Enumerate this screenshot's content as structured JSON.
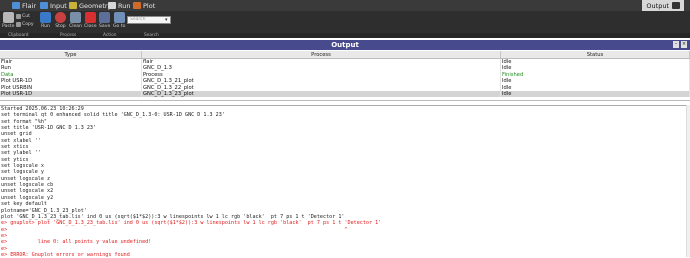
{
  "topbar": {
    "tabs": [
      {
        "label": "Flair",
        "color": "#4e8fd6"
      },
      {
        "label": "Input",
        "color": "#4e8fd6"
      },
      {
        "label": "Geometry",
        "color": "#c9b23a"
      },
      {
        "label": "Run",
        "color": "#d8d8d8"
      },
      {
        "label": "Plot",
        "color": "#d06a2a"
      }
    ],
    "output_tab": "Output"
  },
  "ribbon": {
    "paste": "Paste",
    "cut": "Cut",
    "copy": "Copy",
    "run": "Run",
    "stop": "Stop",
    "clean": "Clean",
    "close": "Close",
    "save": "Save",
    "goto": "Go to",
    "search_placeholder": "Search",
    "groups": [
      "Clipboard",
      "Process",
      "Action",
      "Search"
    ]
  },
  "panel": {
    "title": "Output"
  },
  "table": {
    "headers": [
      "Type",
      "Process",
      "Status"
    ],
    "rows": [
      {
        "type": "Flair",
        "process": "flair",
        "status": "Idle",
        "status_color": "normal"
      },
      {
        "type": "Run",
        "process": "GNC_D_1.3",
        "status": "Idle",
        "status_color": "normal"
      },
      {
        "type": "Data",
        "process": "Process",
        "status": "Finished",
        "status_color": "green"
      },
      {
        "type": "Plot USR-1D",
        "process": "GNC_D_1.3_21_plot",
        "status": "Idle",
        "status_color": "normal"
      },
      {
        "type": "Plot USRBIN",
        "process": "GNC_D_1.3_22_plot",
        "status": "Idle",
        "status_color": "normal"
      },
      {
        "type": "Plot USR-1D",
        "process": "GNC_D_1.3_23_plot",
        "status": "Idle",
        "status_color": "normal",
        "selected": true
      }
    ]
  },
  "log": {
    "lines": [
      {
        "text": "Started 2025.06.23 10:26:29",
        "err": false
      },
      {
        "text": "set terminal qt 0 enhanced solid title 'GNC_D_1.3-0: USR-1D GNC D 1.3 23'",
        "err": false
      },
      {
        "text": "set format \"%h\"",
        "err": false
      },
      {
        "text": "set title 'USR-1D GNC D 1.3 23'",
        "err": false
      },
      {
        "text": "unset grid",
        "err": false
      },
      {
        "text": "set xlabel ''",
        "err": false
      },
      {
        "text": "set xtics",
        "err": false
      },
      {
        "text": "set ylabel ''",
        "err": false
      },
      {
        "text": "set ytics",
        "err": false
      },
      {
        "text": "set logscale x",
        "err": false
      },
      {
        "text": "set logscale y",
        "err": false
      },
      {
        "text": "unset logscale z",
        "err": false
      },
      {
        "text": "unset logscale cb",
        "err": false
      },
      {
        "text": "unset logscale x2",
        "err": false
      },
      {
        "text": "unset logscale y2",
        "err": false
      },
      {
        "text": "set key default",
        "err": false
      },
      {
        "text": "plotname='GNC_D_1.3_23_plot'",
        "err": false
      },
      {
        "text": "plot 'GNC_D_1.3_23_tab.lis' ind 0 us (sqrt($1*$2)):3 w linespoints lw 1 lc rgb 'black'  pt 7 ps 1 t 'Detector 1'",
        "err": false
      },
      {
        "text": "e> gnuplot> plot 'GNC_D_1.3_23_tab.lis' ind 0 us (sqrt($1*$2)):3 w linespoints lw 1 lc rgb 'black'  pt 7 ps 1 t 'Detector 1'",
        "err": true
      },
      {
        "text": "e>                                                                                                              ^",
        "err": true
      },
      {
        "text": "e>",
        "err": true
      },
      {
        "text": "e>          line 0: all points y value undefined!",
        "err": true
      },
      {
        "text": "e>",
        "err": true
      },
      {
        "text": "e> ERROR: Gnuplot errors or warnings found",
        "err": true
      }
    ]
  }
}
